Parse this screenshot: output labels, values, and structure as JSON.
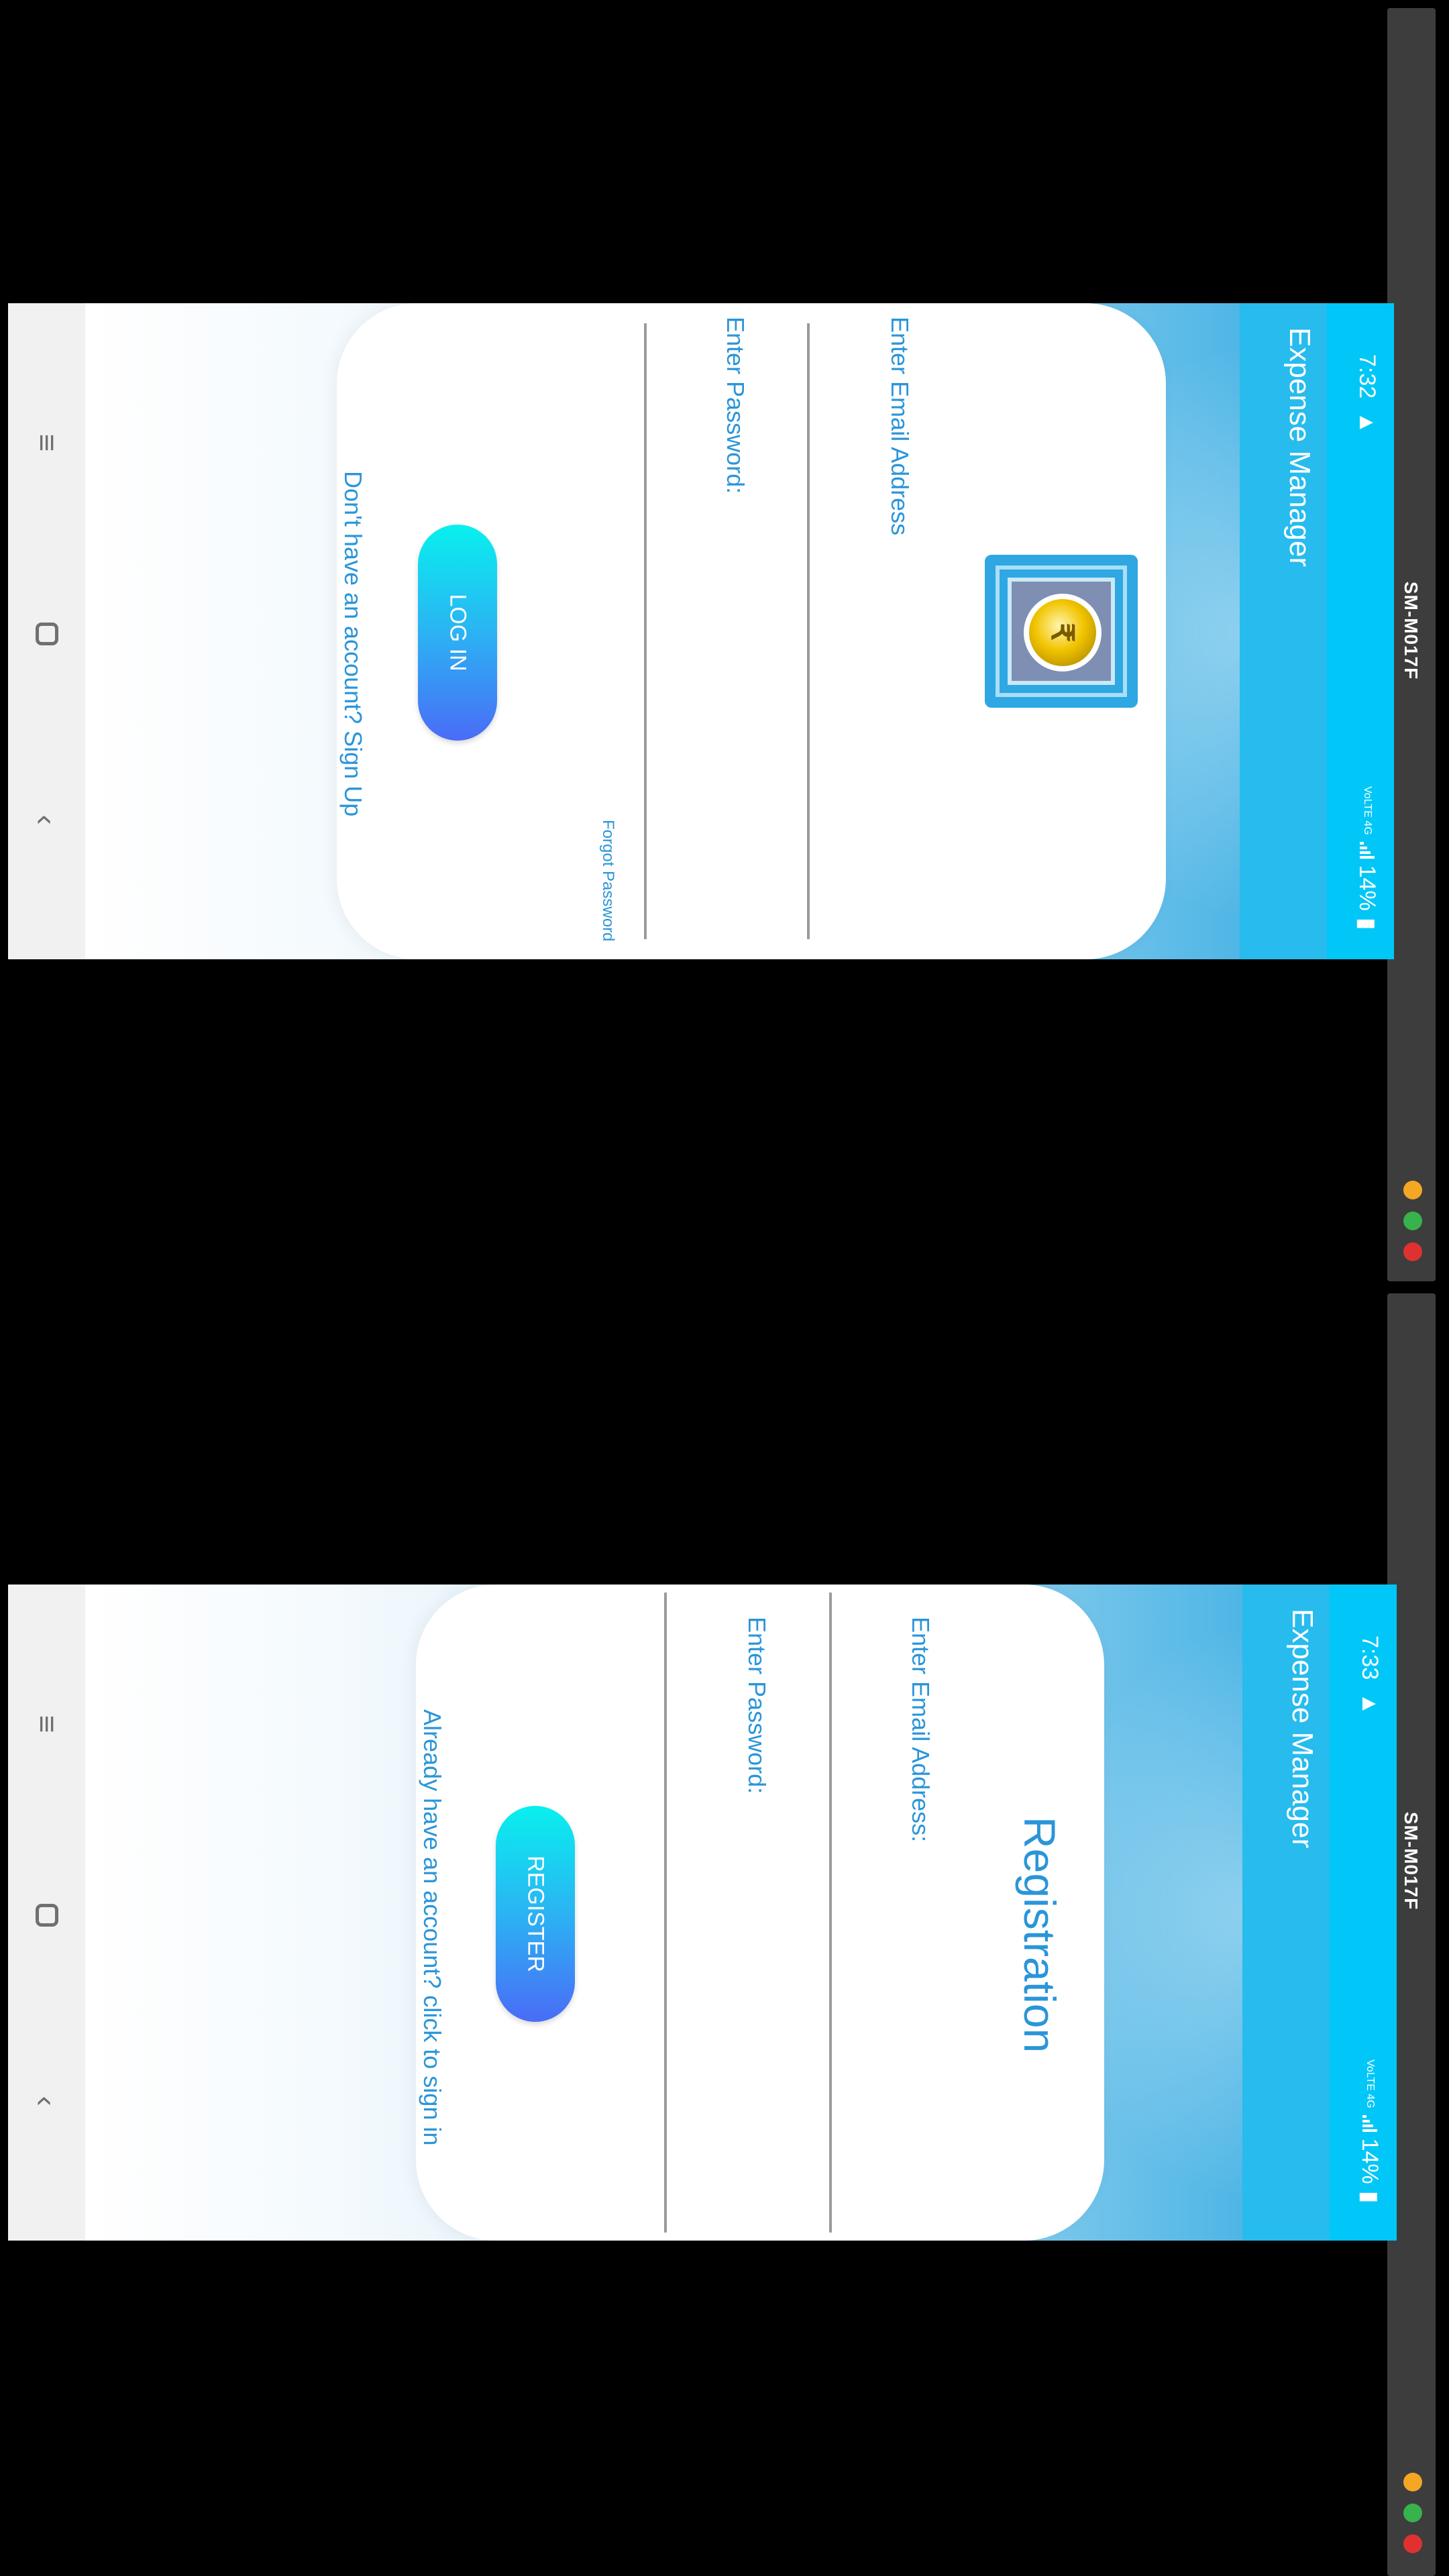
{
  "device_name": "SM-M017F",
  "window_lights": [
    "#f5a623",
    "#37b24d",
    "#e03131"
  ],
  "login_screen": {
    "status_time": "7:32",
    "status_network": "VoLTE 4G",
    "battery": "14%",
    "app_title": "Expense Manager",
    "email_label": "Enter Email Address",
    "password_label": "Enter Password:",
    "forgot_password": "Forgot Password",
    "login_button": "LOG IN",
    "signup_link": "Don't have an account? Sign Up"
  },
  "register_screen": {
    "status_time": "7:33",
    "status_network": "VoLTE 4G",
    "battery": "14%",
    "app_title": "Expense Manager",
    "title": "Registration",
    "email_label": "Enter Email Address:",
    "password_label": "Enter Password:",
    "register_button": "REGISTER",
    "signin_link": "Already have an account? click to sign in"
  },
  "colors": {
    "app_bar": "#27bbee",
    "status_bar": "#00c7f7",
    "accent": "#2a95d9"
  }
}
